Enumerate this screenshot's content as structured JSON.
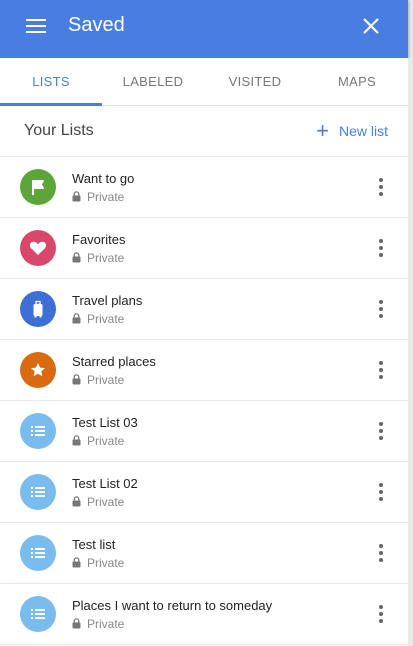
{
  "header": {
    "title": "Saved",
    "bg": "#4a7de2"
  },
  "tabs": [
    {
      "label": "LISTS",
      "active": true
    },
    {
      "label": "LABELED",
      "active": false
    },
    {
      "label": "VISITED",
      "active": false
    },
    {
      "label": "MAPS",
      "active": false
    }
  ],
  "section": {
    "title": "Your Lists",
    "new_list_label": "New list"
  },
  "lists": [
    {
      "name": "Want to go",
      "privacy": "Private",
      "icon": "flag-icon",
      "color": "#5ca53b"
    },
    {
      "name": "Favorites",
      "privacy": "Private",
      "icon": "heart-icon",
      "color": "#d9476a"
    },
    {
      "name": "Travel plans",
      "privacy": "Private",
      "icon": "suitcase-icon",
      "color": "#3e6fd6"
    },
    {
      "name": "Starred places",
      "privacy": "Private",
      "icon": "star-icon",
      "color": "#d86b10"
    },
    {
      "name": "Test List 03",
      "privacy": "Private",
      "icon": "list-icon",
      "color": "#7bbcee"
    },
    {
      "name": "Test List 02",
      "privacy": "Private",
      "icon": "list-icon",
      "color": "#7bbcee"
    },
    {
      "name": "Test list",
      "privacy": "Private",
      "icon": "list-icon",
      "color": "#7bbcee"
    },
    {
      "name": "Places I want to return to someday",
      "privacy": "Private",
      "icon": "list-icon",
      "color": "#7bbcee"
    }
  ]
}
